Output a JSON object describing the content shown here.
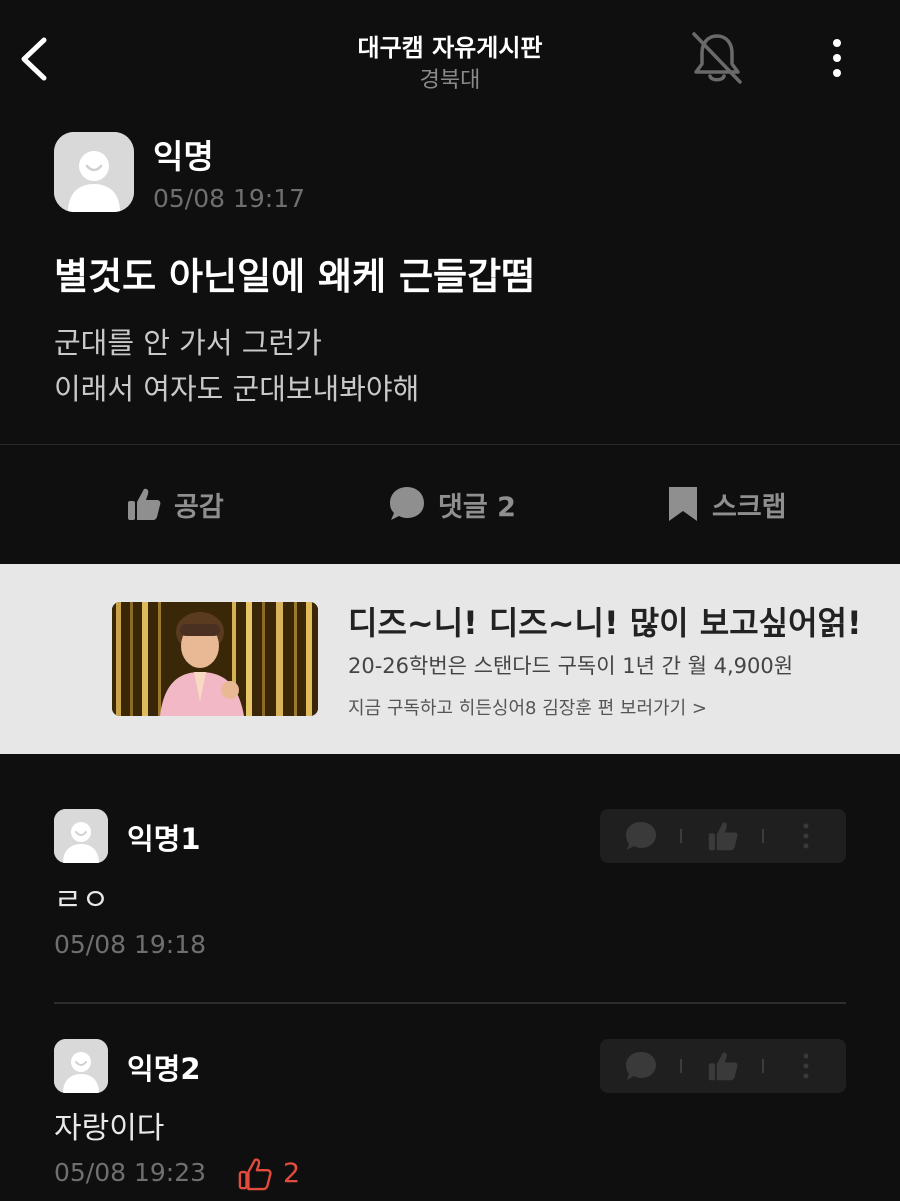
{
  "header": {
    "title": "대구캠 자유게시판",
    "subtitle": "경북대",
    "back_icon": "chevron-left-icon",
    "bell_icon": "bell-off-icon",
    "more_icon": "more-vertical-icon"
  },
  "post": {
    "author": "익명",
    "time": "05/08 19:17",
    "title": "별것도 아닌일에 왜케 근들갑떰",
    "body": "군대를 안 가서 그런가\n이래서 여자도 군대보내봐야해"
  },
  "actions": {
    "like_label": "공감",
    "comment_label": "댓글 2",
    "scrap_label": "스크랩"
  },
  "ad": {
    "title": "디즈~니! 디즈~니! 많이 보고싶어얽!",
    "subtitle": "20-26학번은 스탠다드 구독이 1년 간 월 4,900원",
    "cta": "지금 구독하고 히든싱어8 김장훈 편 보러가기 >"
  },
  "comments": [
    {
      "author": "익명1",
      "text": "ㄹㅇ",
      "time": "05/08 19:18"
    },
    {
      "author": "익명2",
      "text": "자랑이다",
      "time": "05/08 19:23",
      "likes": "2"
    }
  ],
  "colors": {
    "background": "#0f0f0f",
    "like_accent": "#e24c3c",
    "ad_background": "#e7e7e7"
  }
}
